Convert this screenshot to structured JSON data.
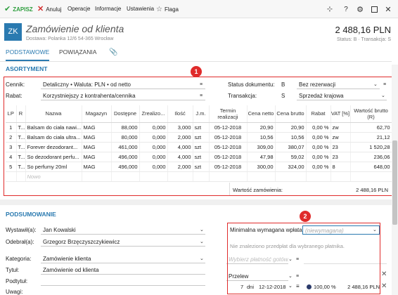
{
  "toolbar": {
    "save_label": "ZAPISZ",
    "cancel_label": "Anuluj",
    "operations_label": "Operacje",
    "info_label": "Informacje",
    "settings_label": "Ustawienia",
    "flag_label": "Flaga"
  },
  "header": {
    "avatar": "ZK",
    "title": "Zamówienie od klienta",
    "subtitle": "Dostawa: Polanka  12/6  54-365 Wrocław",
    "amount": "2 488,16 PLN",
    "status": "Status: B  ·  Transakcja: S"
  },
  "tabs": [
    {
      "label": "PODSTAWOWE"
    },
    {
      "label": "POWIĄZANIA"
    }
  ],
  "assortment": {
    "section_title": "ASORTYMENT",
    "price_list_label": "Cennik:",
    "price_list_value": "Detaliczny • Waluta: PLN • od netto",
    "discount_label": "Rabat:",
    "discount_value": "Korzystniejszy z kontrahenta/cennika",
    "doc_status_label": "Status dokumentu:",
    "doc_status_code": "B",
    "doc_status_value": "Bez rezerwacji",
    "transaction_label": "Transakcja:",
    "transaction_code": "S",
    "transaction_value": "Sprzedaż krajowa",
    "columns": [
      "LP",
      "R",
      "Nazwa",
      "Magazyn",
      "Dostępne",
      "Zrealizo...",
      "Ilość",
      "J.m.",
      "Termin realizacji",
      "Cena netto",
      "Cena brutto",
      "Rabat",
      "VAT [%]",
      "Wartość brutto (R)"
    ],
    "rows": [
      [
        "1",
        "T...",
        "Balsam do ciała nawi...",
        "MAG",
        "88,000",
        "0,000",
        "3,000",
        "szt",
        "05-12-2018",
        "20,90",
        "20,90",
        "0,00 %",
        "zw",
        "62,70"
      ],
      [
        "2",
        "T...",
        "Balsam do ciała ultra...",
        "MAG",
        "80,000",
        "0,000",
        "2,000",
        "szt",
        "05-12-2018",
        "10,56",
        "10,56",
        "0,00 %",
        "zw",
        "21,12"
      ],
      [
        "3",
        "T...",
        "Forever dezodorant...",
        "MAG",
        "461,000",
        "0,000",
        "4,000",
        "szt",
        "05-12-2018",
        "309,00",
        "380,07",
        "0,00 %",
        "23",
        "1 520,28"
      ],
      [
        "4",
        "T...",
        "So dezodorant perfu...",
        "MAG",
        "496,000",
        "0,000",
        "4,000",
        "szt",
        "05-12-2018",
        "47,98",
        "59,02",
        "0,00 %",
        "23",
        "236,06"
      ],
      [
        "5",
        "T...",
        "So perfumy 20ml",
        "MAG",
        "496,000",
        "0,000",
        "2,000",
        "szt",
        "05-12-2018",
        "300,00",
        "324,00",
        "0,00 %",
        "8",
        "648,00"
      ]
    ],
    "new_row_placeholder": "Nowo",
    "order_value_label": "Wartość zamówienia:",
    "order_value": "2 488,16 PLN",
    "badge": "1"
  },
  "summary": {
    "section_title": "PODSUMOWANIE",
    "issued_by_label": "Wystawił(a):",
    "issued_by_value": "Jan Kowalski",
    "received_by_label": "Odebrał(a):",
    "received_by_value": "Grzegorz Brzęczyszczykiewicz",
    "category_label": "Kategoria:",
    "category_value": "Zamówienie klienta",
    "title_label": "Tytuł:",
    "title_value": "Zamówienie od klienta",
    "subtitle_label": "Podtytuł:",
    "notes_label": "Uwagi:",
    "min_payment_label": "Minimalna wymagana wpłata:",
    "min_payment_placeholder": "(niewymagana)",
    "no_prepayment_text": "Nie znaleziono przedpłat dla wybranego płatnika.",
    "payment_placeholder": "Wybierz płatność gotów...",
    "transfer_label": "Przelew",
    "days_value": "7",
    "days_label": "dni",
    "due_date": "12-12-2018",
    "percent": "100,00 %",
    "transfer_amount": "2 488,16 PLN",
    "badge": "2"
  },
  "colors": {
    "accent": "#2a7ab0",
    "save_green": "#2e9e3e",
    "cancel_red": "#d32f2f",
    "annotation_red": "#e02b2b"
  }
}
